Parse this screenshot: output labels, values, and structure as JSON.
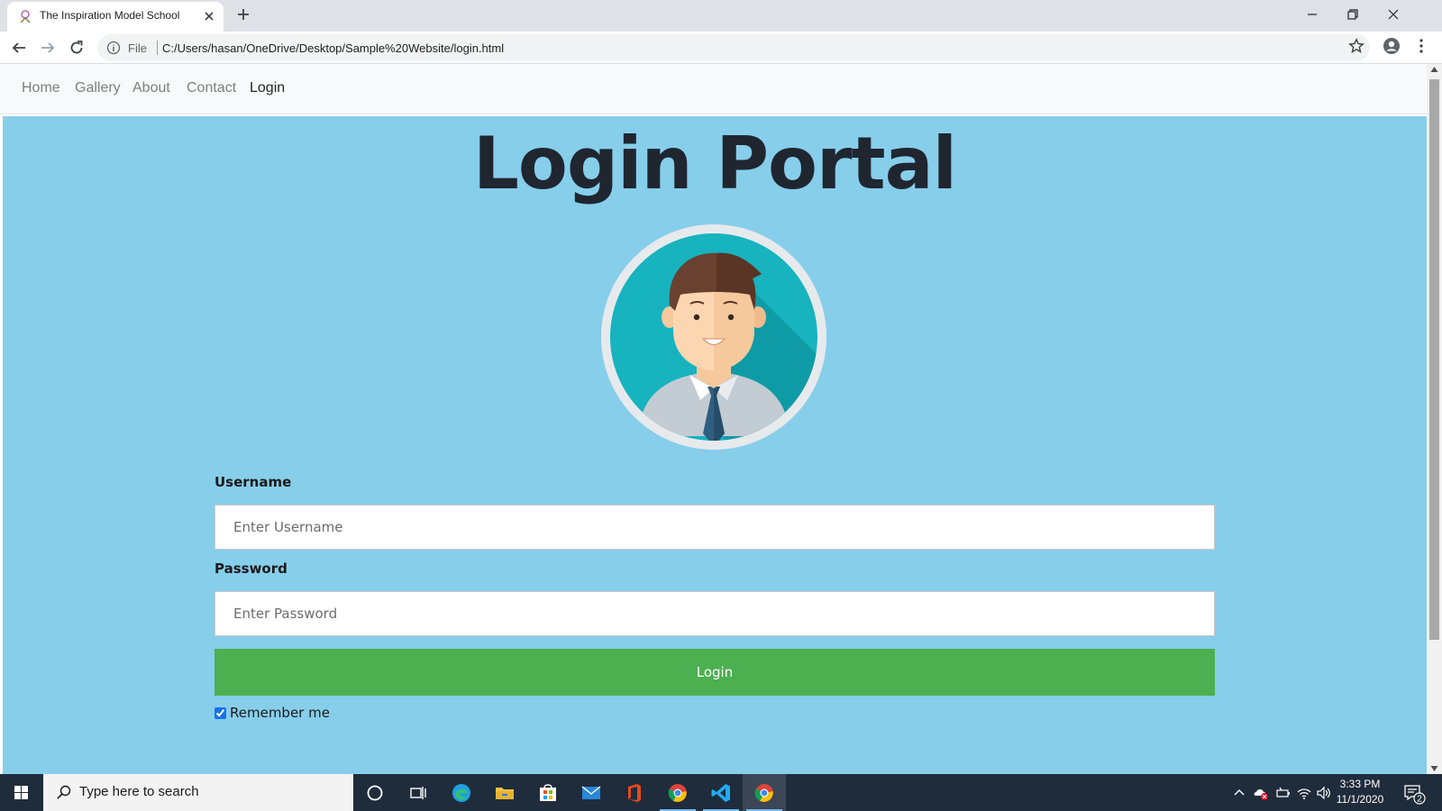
{
  "browser": {
    "tab_title": "The Inspiration Model School",
    "omnibox_scheme": "File",
    "url": "C:/Users/hasan/OneDrive/Desktop/Sample%20Website/login.html"
  },
  "site_nav": {
    "links": [
      {
        "label": "Home",
        "active": false
      },
      {
        "label": "Gallery",
        "active": false
      },
      {
        "label": "About",
        "active": false
      },
      {
        "label": "Contact",
        "active": false
      },
      {
        "label": "Login",
        "active": true
      }
    ]
  },
  "login": {
    "title": "Login Portal",
    "username_label": "Username",
    "username_placeholder": "Enter Username",
    "password_label": "Password",
    "password_placeholder": "Enter Password",
    "submit_label": "Login",
    "remember_label": "Remember me",
    "remember_checked": true
  },
  "taskbar": {
    "search_placeholder": "Type here to search",
    "time": "3:33 PM",
    "date": "11/1/2020",
    "notification_count": "2",
    "apps": [
      "cortana-icon",
      "task-view-icon",
      "edge-icon",
      "file-explorer-icon",
      "store-icon",
      "mail-icon",
      "office-icon",
      "chrome-icon",
      "vscode-icon",
      "chrome-icon"
    ]
  },
  "colors": {
    "content_bg": "#87ceeb",
    "login_button": "#4caf50",
    "taskbar": "#1f2c3c"
  }
}
